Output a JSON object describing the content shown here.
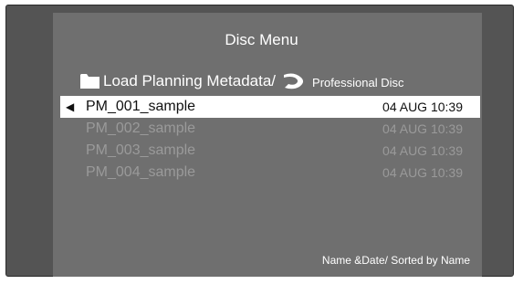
{
  "menu": {
    "title": "Disc Menu",
    "path": "Load Planning Metadata/",
    "disc_label": "Professional Disc",
    "footer": "Name &Date/ Sorted by Name"
  },
  "files": [
    {
      "name": "PM_001_sample",
      "date": "04 AUG 10:39",
      "selected": true
    },
    {
      "name": "PM_002_sample",
      "date": "04 AUG 10:39",
      "selected": false
    },
    {
      "name": "PM_003_sample",
      "date": "04 AUG 10:39",
      "selected": false
    },
    {
      "name": "PM_004_sample",
      "date": "04 AUG 10:39",
      "selected": false
    }
  ],
  "icons": {
    "folder": "folder-icon",
    "disc": "professional-disc-icon",
    "cursor": "cursor-arrow-icon"
  },
  "colors": {
    "background": "#545454",
    "panel": "#6f6f6f",
    "selection": "#ffffff",
    "dim_text": "#9a9a9a"
  }
}
